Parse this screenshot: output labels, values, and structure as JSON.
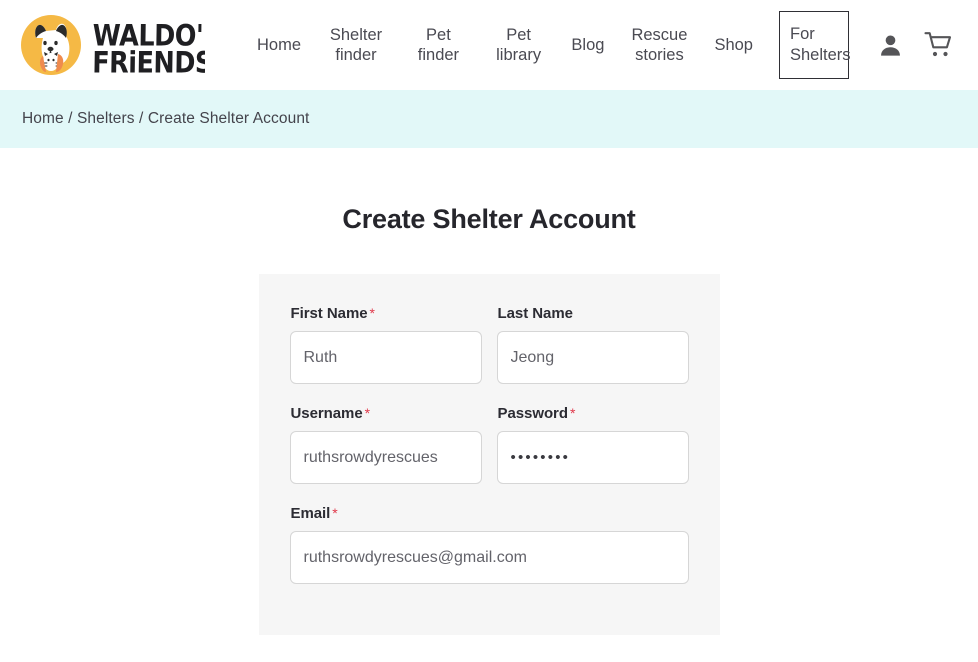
{
  "header": {
    "brand": {
      "name": "Waldo's Friends",
      "wordmark_line1": "WALDO'S",
      "wordmark_line2": "FRiENDS",
      "logo_icon": "dog-and-cat-logo-icon",
      "logo_circle_color": "#F5B945"
    },
    "nav": [
      {
        "label": "Home",
        "name": "nav-home",
        "boxed": false,
        "single_line": true
      },
      {
        "label": "Shelter finder",
        "name": "nav-shelter-finder",
        "boxed": false,
        "single_line": false
      },
      {
        "label": "Pet finder",
        "name": "nav-pet-finder",
        "boxed": false,
        "single_line": false
      },
      {
        "label": "Pet library",
        "name": "nav-pet-library",
        "boxed": false,
        "single_line": false
      },
      {
        "label": "Blog",
        "name": "nav-blog",
        "boxed": false,
        "single_line": true
      },
      {
        "label": "Rescue stories",
        "name": "nav-rescue-stories",
        "boxed": false,
        "single_line": false
      },
      {
        "label": "Shop",
        "name": "nav-shop",
        "boxed": false,
        "single_line": true
      },
      {
        "label": "For Shelters",
        "name": "nav-for-shelters",
        "boxed": true,
        "single_line": false
      }
    ],
    "actions": [
      {
        "name": "account-icon",
        "icon": "user-account-icon",
        "label": "Account"
      },
      {
        "name": "cart-icon",
        "icon": "shopping-cart-icon",
        "label": "Cart"
      }
    ]
  },
  "breadcrumb": {
    "text": "Home / Shelters / Create Shelter Account",
    "background_color": "#e2f8f8",
    "items": [
      "Home",
      "Shelters",
      "Create Shelter Account"
    ],
    "separator": "/"
  },
  "main": {
    "page_title": "Create Shelter Account",
    "form": {
      "required_marker": "*",
      "required_marker_color": "#e0384a",
      "card_background": "#f6f6f6",
      "fields": {
        "first_name": {
          "label": "First Name",
          "value": "Ruth",
          "required": true
        },
        "last_name": {
          "label": "Last Name",
          "value": "Jeong",
          "required": false
        },
        "username": {
          "label": "Username",
          "value": "ruthsrowdyrescues",
          "required": true
        },
        "password": {
          "label": "Password",
          "value": "••••••••",
          "masked_char_count": 8,
          "required": true
        },
        "email": {
          "label": "Email",
          "value": "ruthsrowdyrescues@gmail.com",
          "required": true
        }
      }
    }
  }
}
